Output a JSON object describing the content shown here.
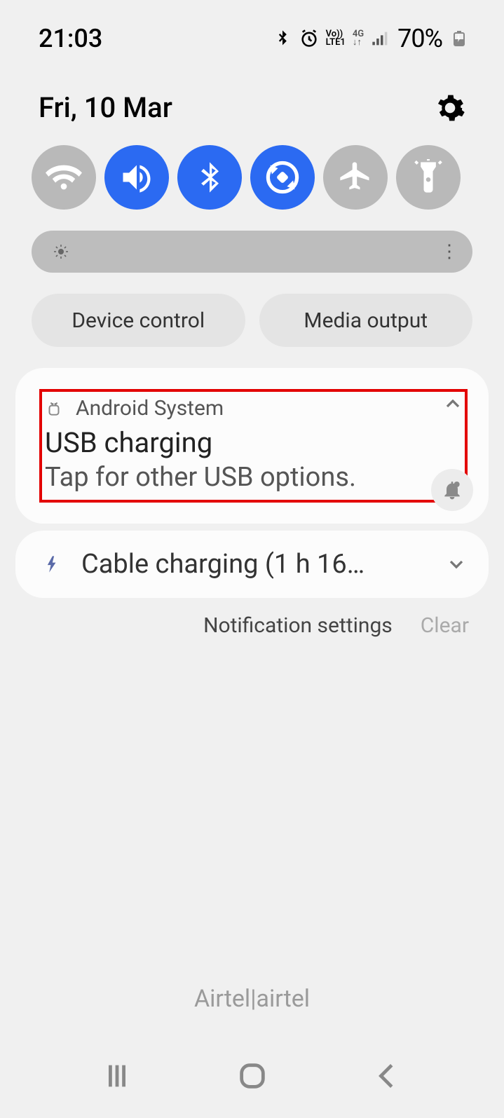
{
  "status": {
    "time": "21:03",
    "battery_pct": "70%",
    "net_label1": "Vo))",
    "net_label2": "LTE1",
    "net_label3": "4G"
  },
  "header": {
    "date": "Fri, 10 Mar"
  },
  "toggles": {
    "wifi": {
      "on": false
    },
    "sound": {
      "on": true
    },
    "bluetooth": {
      "on": true
    },
    "rotate": {
      "on": true
    },
    "airplane": {
      "on": false
    },
    "torch": {
      "on": false
    }
  },
  "chips": {
    "device_control": "Device control",
    "media_output": "Media output"
  },
  "notif1": {
    "app": "Android System",
    "title": "USB charging",
    "sub": "Tap for other USB options."
  },
  "notif2": {
    "text": "Cable charging (1 h 16…"
  },
  "links": {
    "settings": "Notification settings",
    "clear": "Clear"
  },
  "carrier": "Airtel|airtel"
}
